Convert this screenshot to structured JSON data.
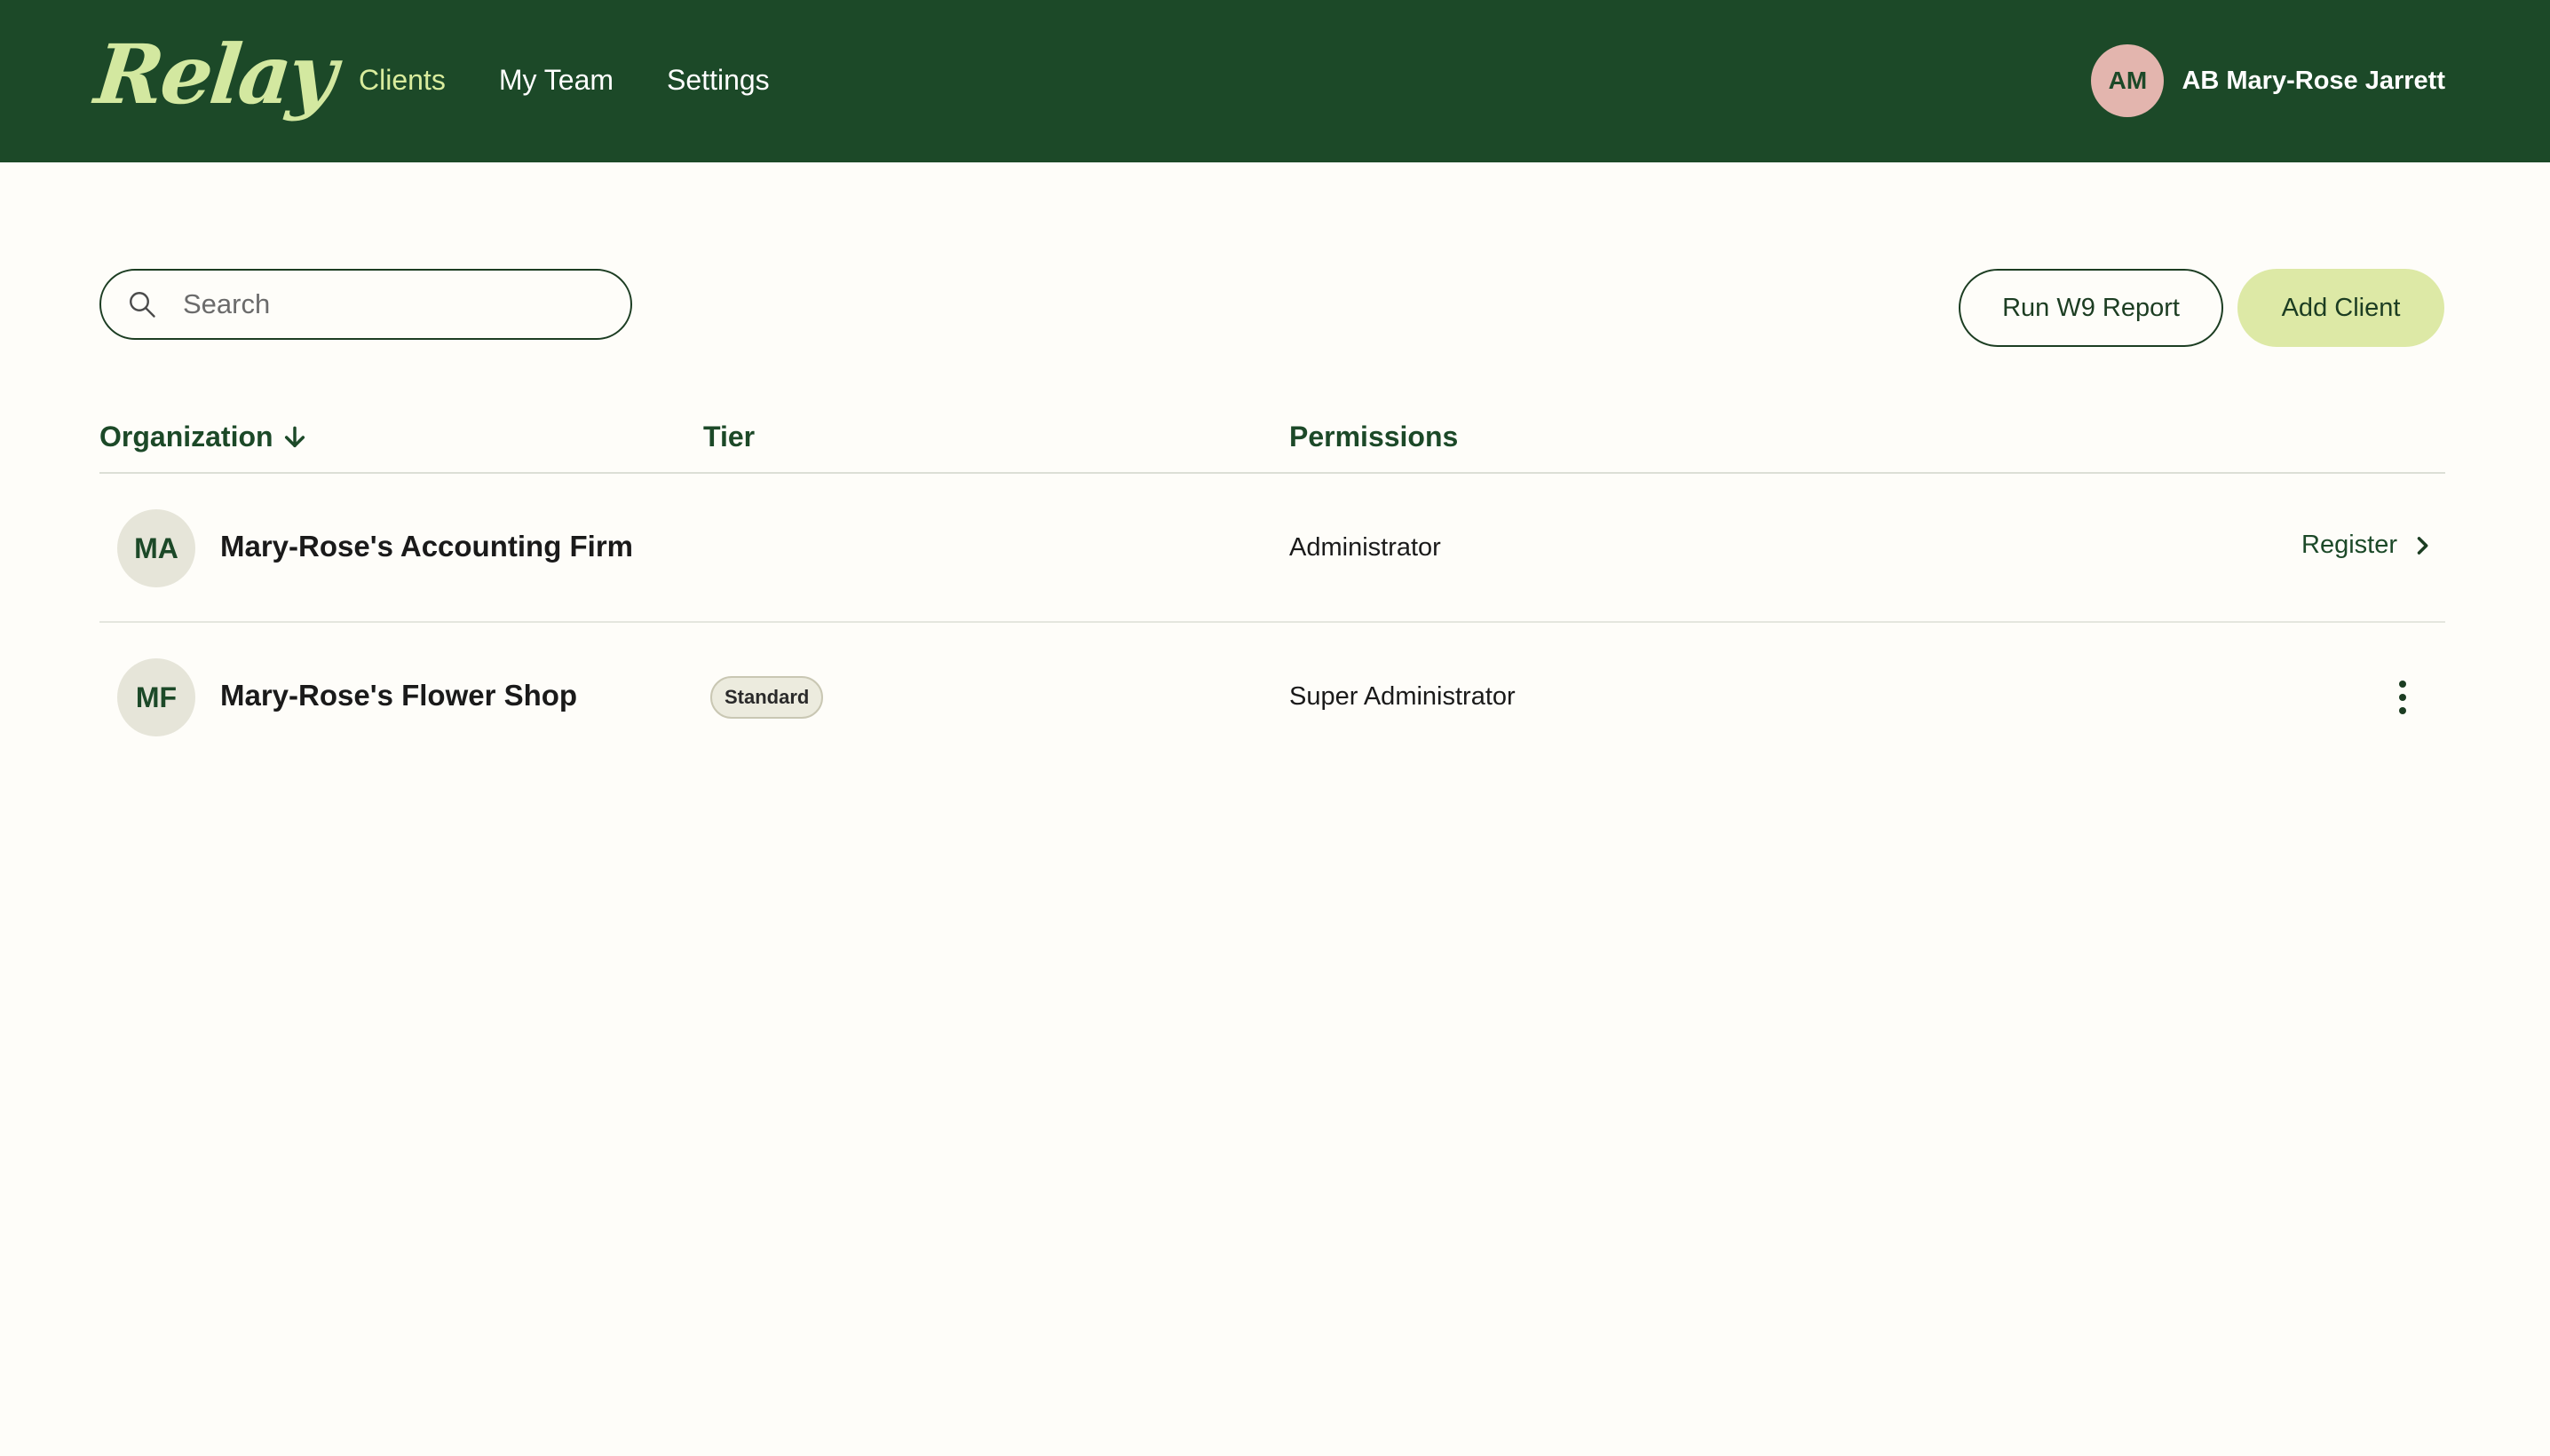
{
  "header": {
    "logo_text": "Relay",
    "nav": [
      {
        "label": "Clients",
        "active": true
      },
      {
        "label": "My Team",
        "active": false
      },
      {
        "label": "Settings",
        "active": false
      }
    ],
    "user": {
      "initials": "AM",
      "name": "AB Mary-Rose Jarrett"
    }
  },
  "toolbar": {
    "search_placeholder": "Search",
    "search_value": "",
    "w9_button_label": "Run W9 Report",
    "add_client_label": "Add Client"
  },
  "table": {
    "columns": {
      "organization": "Organization",
      "tier": "Tier",
      "permissions": "Permissions"
    },
    "sort": {
      "column": "Organization",
      "direction": "descending",
      "icon": "arrow-down-icon"
    },
    "rows": [
      {
        "initials": "MA",
        "organization": "Mary-Rose's Accounting Firm",
        "tier": "",
        "permissions": "Administrator",
        "action_label": "Register",
        "action_icon": "chevron-right-icon"
      },
      {
        "initials": "MF",
        "organization": "Mary-Rose's Flower Shop",
        "tier": "Standard",
        "permissions": "Super Administrator",
        "action_icon": "more-vertical-icon"
      }
    ]
  },
  "colors": {
    "header_bg": "#1c4928",
    "accent": "#d9ec9d",
    "primary_button": "#dde9a6",
    "user_avatar": "#e3b5ae",
    "page_bg": "#fefdf9"
  }
}
